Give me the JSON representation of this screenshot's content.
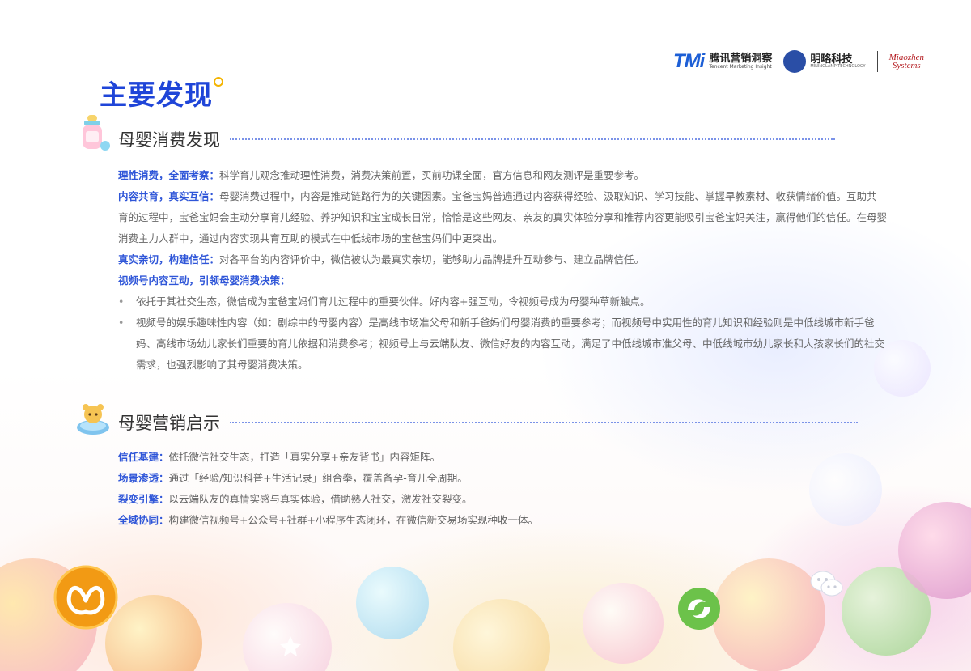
{
  "header": {
    "logo_tmi": {
      "mark": "TMi",
      "cn": "腾讯营销洞察",
      "en": "Tencent Marketing Insight"
    },
    "logo_mingluo": {
      "cn": "明略科技",
      "en": "MININGLAMP TECHNOLOGY"
    },
    "logo_miaozhen": {
      "line1": "Miaozhen",
      "line2": "Systems"
    }
  },
  "title": "主要发现",
  "section1": {
    "heading": "母婴消费发现",
    "items": [
      {
        "key": "理性消费，全面考察：",
        "text": "科学育儿观念推动理性消费，消费决策前置，买前功课全面，官方信息和网友测评是重要参考。"
      },
      {
        "key": "内容共育，真实互信：",
        "text": "母婴消费过程中，内容是推动链路行为的关键因素。宝爸宝妈普遍通过内容获得经验、汲取知识、学习技能、掌握早教素材、收获情绪价值。互助共育的过程中，宝爸宝妈会主动分享育儿经验、养护知识和宝宝成长日常，恰恰是这些网友、亲友的真实体验分享和推荐内容更能吸引宝爸宝妈关注，赢得他们的信任。在母婴消费主力人群中，通过内容实现共育互助的模式在中低线市场的宝爸宝妈们中更突出。"
      },
      {
        "key": "真实亲切，构建信任：",
        "text": "对各平台的内容评价中，微信被认为最真实亲切，能够助力品牌提升互动参与、建立品牌信任。"
      },
      {
        "key": "视频号内容互动，引领母婴消费决策：",
        "text": ""
      }
    ],
    "bullets": [
      "依托于其社交生态，微信成为宝爸宝妈们育儿过程中的重要伙伴。好内容+强互动，令视频号成为母婴种草新触点。",
      "视频号的娱乐趣味性内容（如：剧综中的母婴内容）是高线市场准父母和新手爸妈们母婴消费的重要参考；而视频号中实用性的育儿知识和经验则是中低线城市新手爸妈、高线市场幼儿家长们重要的育儿依据和消费参考；视频号上与云端队友、微信好友的内容互动，满足了中低线城市准父母、中低线城市幼儿家长和大孩家长们的社交需求，也强烈影响了其母婴消费决策。"
    ]
  },
  "section2": {
    "heading": "母婴营销启示",
    "items": [
      {
        "key": "信任基建：",
        "text": "依托微信社交生态，打造「真实分享+亲友背书」内容矩阵。"
      },
      {
        "key": "场景渗透：",
        "text": "通过「经验/知识科普+生活记录」组合拳，覆盖备孕-育儿全周期。"
      },
      {
        "key": "裂变引擎：",
        "text": "以云端队友的真情实感与真实体验，借助熟人社交，激发社交裂变。"
      },
      {
        "key": "全域协同：",
        "text": "构建微信视频号+公众号+社群+小程序生态闭环，在微信新交易场实现种收一体。"
      }
    ]
  },
  "colors": {
    "accent": "#1f45d8",
    "keyword": "#2f56d8",
    "dot": "#f4b400",
    "rule": "#7a92e8"
  },
  "icons": [
    "baby-bottle-icon",
    "bear-cup-icon",
    "butterfly-logo-icon",
    "swirl-logo-icon",
    "wechat-icon",
    "star-icon"
  ]
}
